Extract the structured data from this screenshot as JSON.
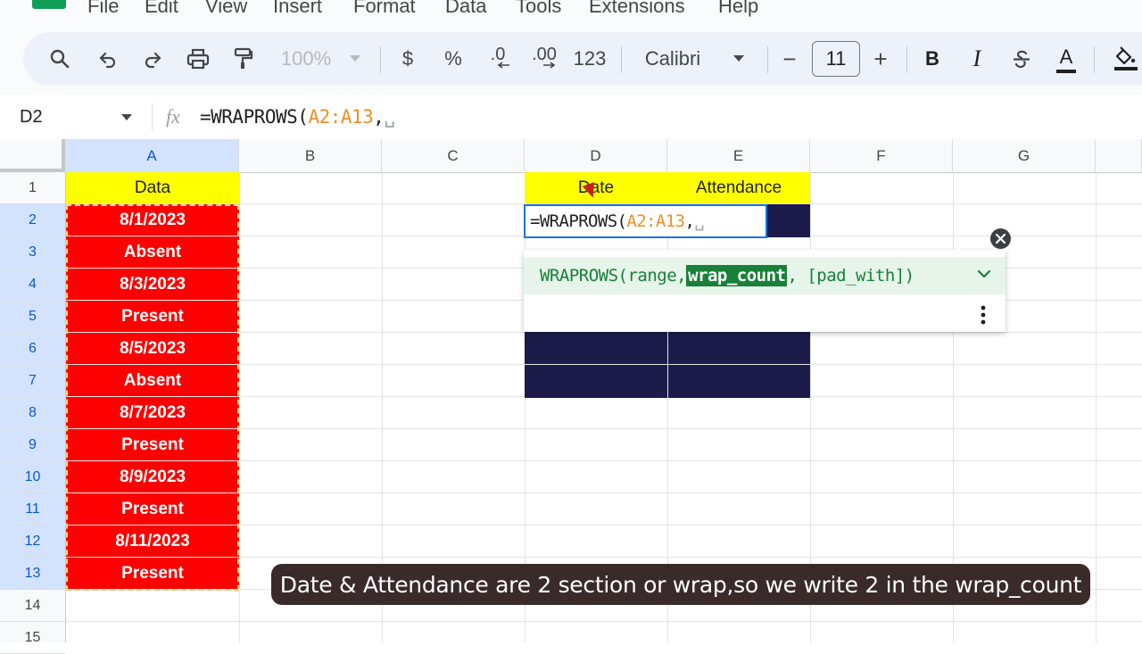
{
  "menu": [
    "File",
    "Edit",
    "View",
    "Insert",
    "Format",
    "Data",
    "Tools",
    "Extensions",
    "Help"
  ],
  "toolbar": {
    "zoom": "100%",
    "currency": "$",
    "percent": "%",
    "decrease_decimal": ".0",
    "increase_decimal": ".00",
    "more_formats": "123",
    "font": "Calibri",
    "font_size": "11",
    "minus": "−",
    "plus": "+",
    "bold": "B",
    "italic": "I",
    "text_color": "A"
  },
  "formula_bar": {
    "name_box": "D2",
    "fx": "fx",
    "formula_prefix": "=WRAPROWS(",
    "formula_range": "A2:A13",
    "formula_suffix": ","
  },
  "columns": [
    "A",
    "B",
    "C",
    "D",
    "E",
    "F",
    "G"
  ],
  "rows": [
    "1",
    "2",
    "3",
    "4",
    "5",
    "6",
    "7",
    "8",
    "9",
    "10",
    "11",
    "12",
    "13",
    "14",
    "15"
  ],
  "cells": {
    "a1": "Data",
    "d1": "Date",
    "e1": "Attendance",
    "column_a": [
      "8/1/2023",
      "Absent",
      "8/3/2023",
      "Present",
      "8/5/2023",
      "Absent",
      "8/7/2023",
      "Present",
      "8/9/2023",
      "Present",
      "8/11/2023",
      "Present"
    ]
  },
  "edit_cell": {
    "prefix": "=WRAPROWS(",
    "range": "A2:A13",
    "suffix": ","
  },
  "function_help": {
    "name": "WRAPROWS(",
    "arg1": "range, ",
    "arg2": "wrap_count",
    "arg3": ", [pad_with])"
  },
  "caption": "Date & Attendance are 2 section or wrap,so we write 2 in the wrap_count",
  "colors": {
    "data_fill": "#ff0000",
    "header_fill": "#ffff00",
    "result_fill": "#1c1b4a",
    "edit_border": "#1a73e8",
    "range_text": "#e8912d",
    "help_green": "#188038"
  }
}
